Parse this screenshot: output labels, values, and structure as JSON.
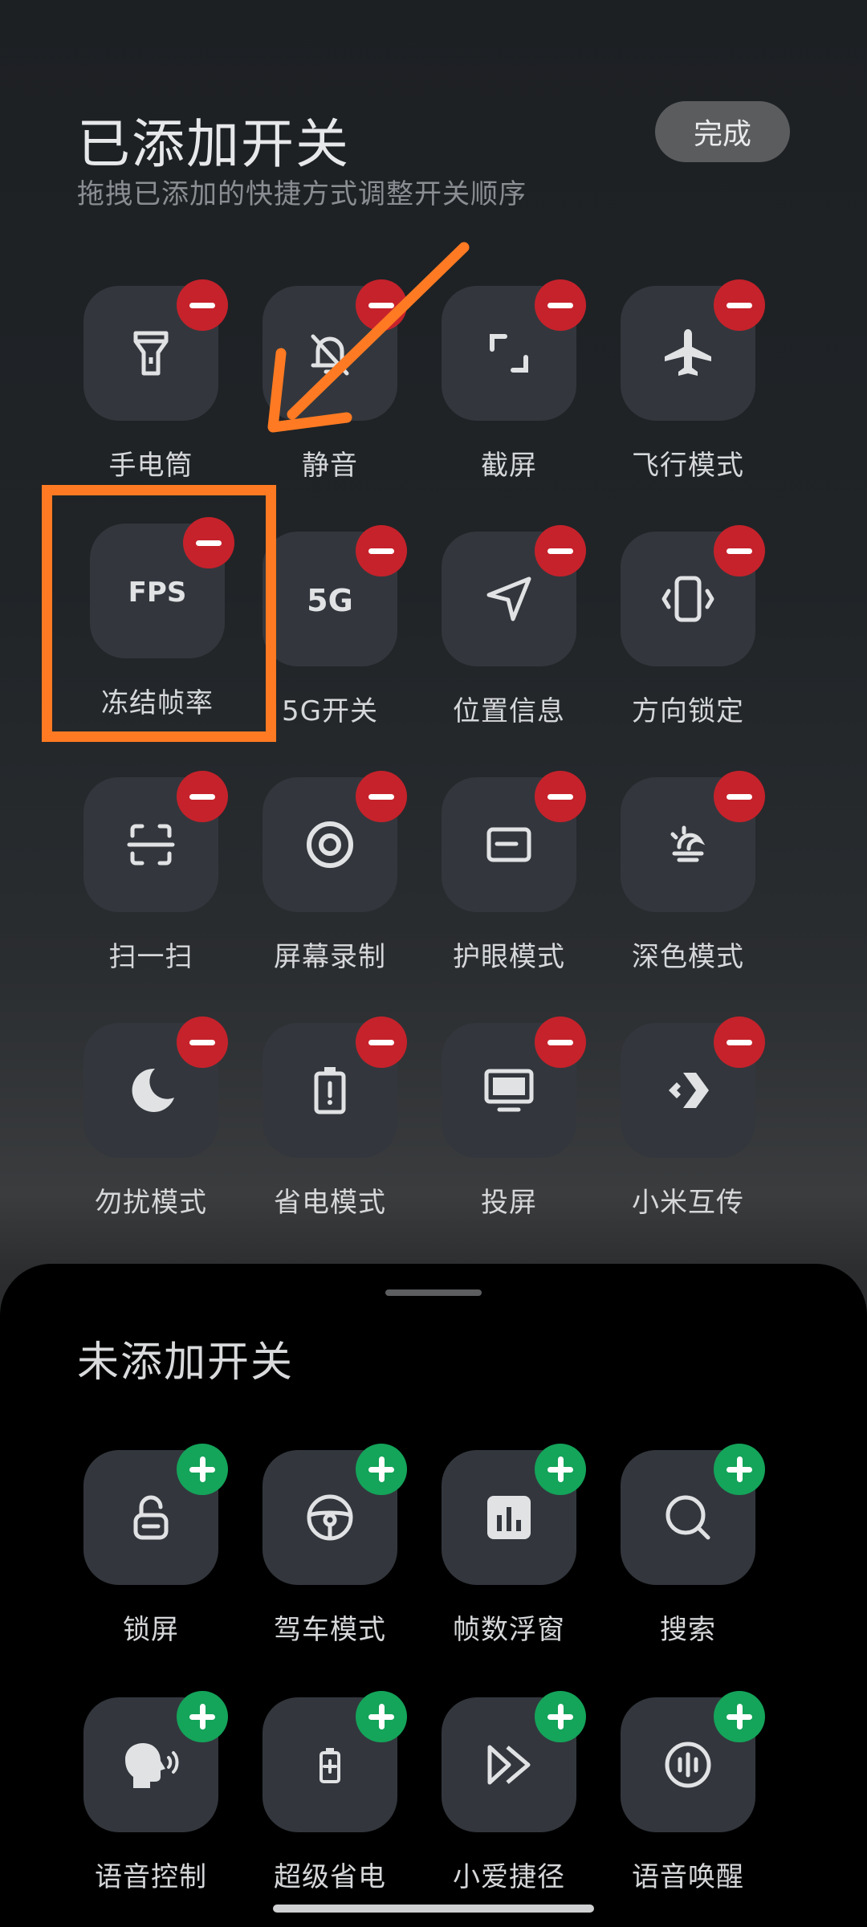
{
  "header": {
    "title": "已添加开关",
    "subtitle": "拖拽已添加的快捷方式调整开关顺序",
    "done_label": "完成"
  },
  "added_toggles": [
    {
      "label": "手电筒",
      "icon": "flashlight-icon"
    },
    {
      "label": "静音",
      "icon": "mute-bell-icon"
    },
    {
      "label": "截屏",
      "icon": "screenshot-icon"
    },
    {
      "label": "飞行模式",
      "icon": "airplane-icon"
    },
    {
      "label": "冻结帧率",
      "icon": "fps-icon",
      "icon_text": "FPS"
    },
    {
      "label": "5G开关",
      "icon": "5g-icon",
      "icon_text": "5G"
    },
    {
      "label": "位置信息",
      "icon": "location-icon"
    },
    {
      "label": "方向锁定",
      "icon": "rotation-lock-icon"
    },
    {
      "label": "扫一扫",
      "icon": "scan-icon"
    },
    {
      "label": "屏幕录制",
      "icon": "screen-record-icon"
    },
    {
      "label": "护眼模式",
      "icon": "eye-comfort-icon"
    },
    {
      "label": "深色模式",
      "icon": "dark-mode-icon"
    },
    {
      "label": "勿扰模式",
      "icon": "moon-icon"
    },
    {
      "label": "省电模式",
      "icon": "battery-saver-icon"
    },
    {
      "label": "投屏",
      "icon": "cast-screen-icon"
    },
    {
      "label": "小米互传",
      "icon": "mi-share-icon"
    }
  ],
  "sheet": {
    "title": "未添加开关"
  },
  "unadded_toggles": [
    {
      "label": "锁屏",
      "icon": "lock-icon"
    },
    {
      "label": "驾车模式",
      "icon": "steering-wheel-icon"
    },
    {
      "label": "帧数浮窗",
      "icon": "bar-chart-icon"
    },
    {
      "label": "搜索",
      "icon": "search-icon"
    },
    {
      "label": "语音控制",
      "icon": "voice-control-icon"
    },
    {
      "label": "超级省电",
      "icon": "ultra-battery-saver-icon"
    },
    {
      "label": "小爱捷径",
      "icon": "fast-forward-icon"
    },
    {
      "label": "语音唤醒",
      "icon": "voice-wake-icon"
    }
  ],
  "colors": {
    "remove_badge": "#c6222b",
    "add_badge": "#14a45a",
    "annotation": "#ff7a22",
    "tile": "#33373d"
  }
}
